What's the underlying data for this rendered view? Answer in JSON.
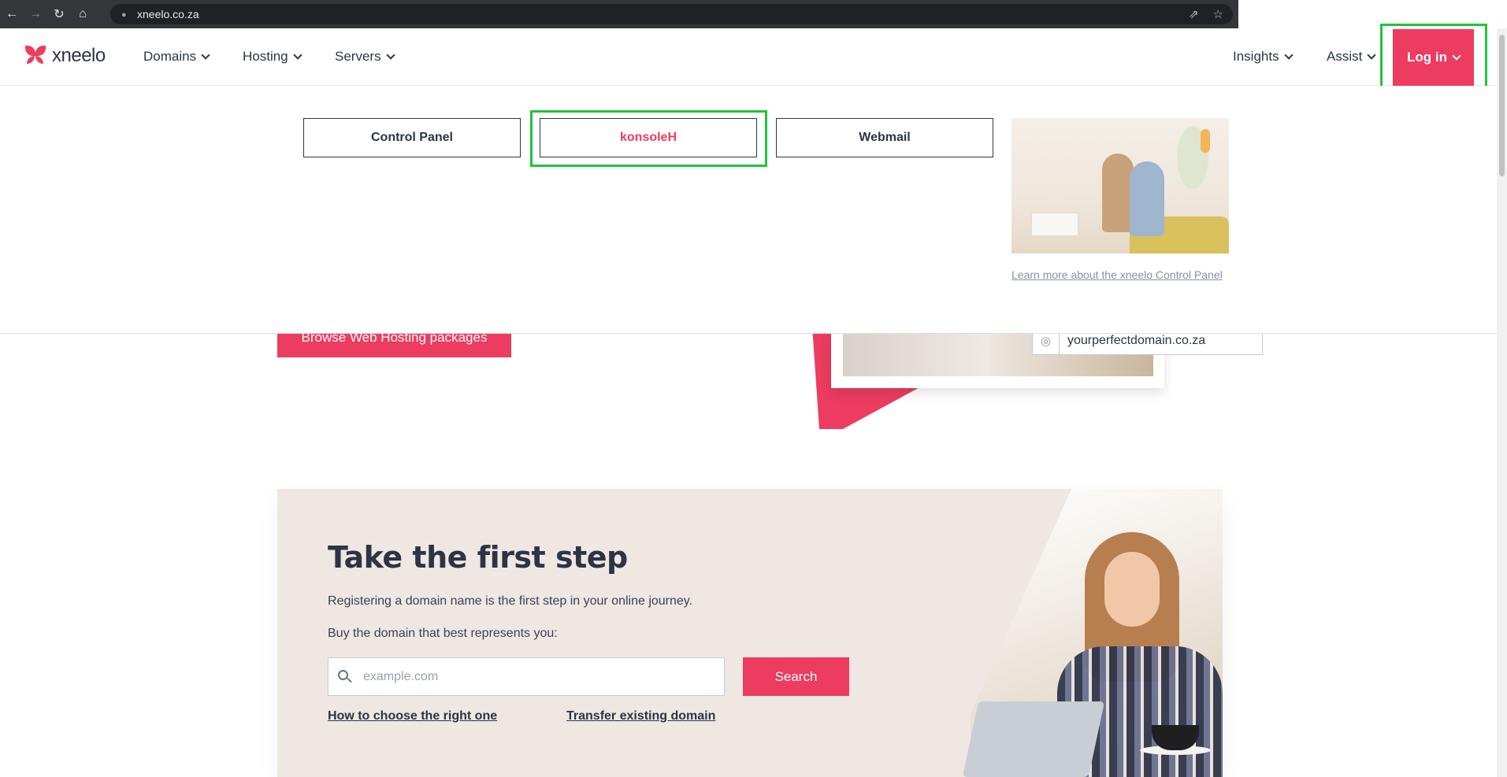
{
  "browser": {
    "url": "xneelo.co.za"
  },
  "header": {
    "logo": "xneelo",
    "nav": {
      "domains": "Domains",
      "hosting": "Hosting",
      "servers": "Servers",
      "insights": "Insights",
      "assist": "Assist"
    },
    "login": "Log in"
  },
  "login_menu": {
    "control_panel": "Control Panel",
    "konsoleh": "konsoleH",
    "webmail": "Webmail",
    "learn_more": "Learn more about the xneelo Control Panel"
  },
  "hero": {
    "browse_button": "Browse Web Hosting packages",
    "domain_example": "yourperfectdomain.co.za"
  },
  "promo": {
    "title": "Take the first step",
    "text1": "Registering a domain name is the first step in your online journey.",
    "text2": "Buy the domain that best represents you:",
    "search_placeholder": "example.com",
    "search_button": "Search",
    "link_choose": "How to choose the right one",
    "link_transfer": "Transfer existing domain"
  },
  "colors": {
    "brand": "#ec3c5f",
    "text": "#2d3446",
    "highlight": "#22c33c",
    "promo_bg": "#efe7e2"
  }
}
